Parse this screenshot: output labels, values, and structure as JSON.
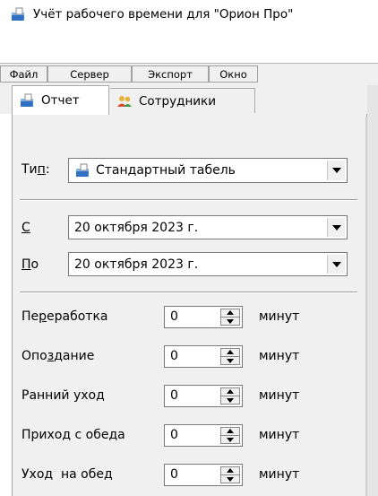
{
  "window": {
    "title": "Учёт рабочего времени для \"Орион Про\""
  },
  "menu": [
    "Файл",
    "Сервер",
    "Экспорт",
    "Окно"
  ],
  "tabs": [
    {
      "label": "Отчет",
      "icon": "report-icon",
      "active": true
    },
    {
      "label": "Сотрудники",
      "icon": "employees-icon",
      "active": false
    }
  ],
  "report": {
    "type_label_pre": "Ти",
    "type_label_acc": "п",
    "type_label_post": ":",
    "type_value": "Стандартный табель",
    "from_label_acc": "С",
    "from_value": "20  октября  2023 г.",
    "to_label_acc": "П",
    "to_label_post": "о",
    "to_value": "20  октября  2023 г."
  },
  "fields": [
    {
      "pre": "Пе",
      "acc": "р",
      "post": "еработка",
      "value": "0",
      "unit": "минут"
    },
    {
      "pre": "Опо",
      "acc": "з",
      "post": "дание",
      "value": "0",
      "unit": "минут"
    },
    {
      "pre": "Ранний уход",
      "acc": "",
      "post": "",
      "value": "0",
      "unit": "минут"
    },
    {
      "pre": "Приход с обеда",
      "acc": "",
      "post": "",
      "value": "0",
      "unit": "минут"
    },
    {
      "pre": "Уход  на обед",
      "acc": "",
      "post": "",
      "value": "0",
      "unit": "минут"
    }
  ],
  "colors": {
    "panel_bg": "#f0f0f0",
    "border": "#a9a9a9",
    "icon_blue": "#3a7bd5"
  }
}
